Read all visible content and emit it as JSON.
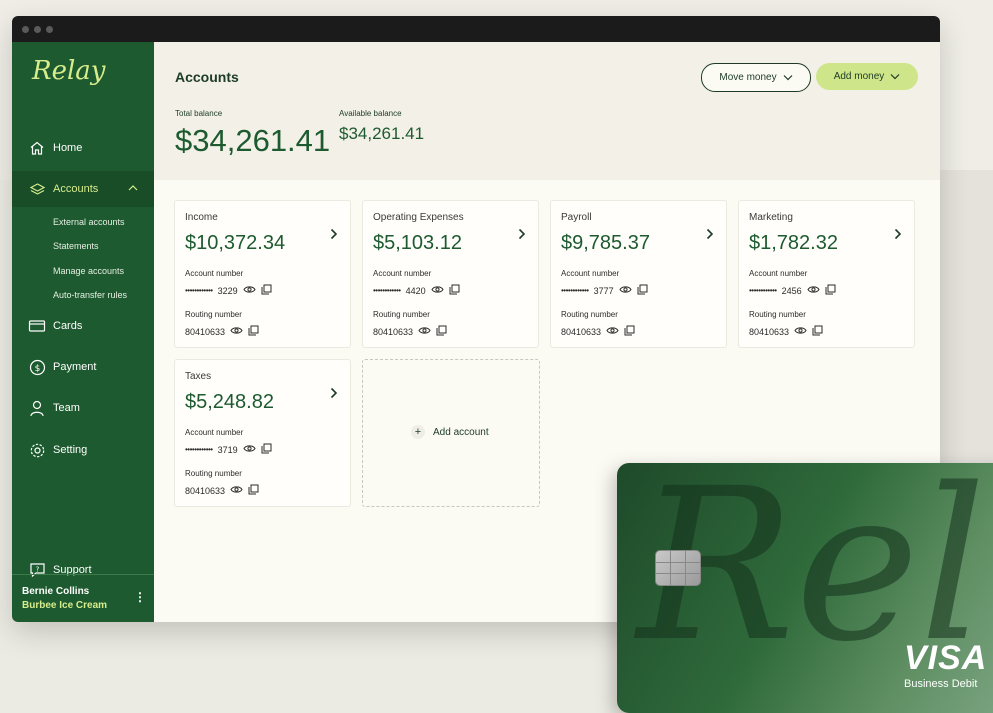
{
  "app": {
    "logo": "Relay"
  },
  "sidebar": {
    "items": [
      {
        "label": "Home",
        "icon": "home-icon"
      },
      {
        "label": "Accounts",
        "icon": "layers-icon",
        "active": true
      },
      {
        "label": "Cards",
        "icon": "card-icon"
      },
      {
        "label": "Payment",
        "icon": "dollar-icon"
      },
      {
        "label": "Team",
        "icon": "person-icon"
      },
      {
        "label": "Setting",
        "icon": "gear-icon"
      }
    ],
    "subitems": [
      "External accounts",
      "Statements",
      "Manage accounts",
      "Auto-transfer rules"
    ],
    "support": "Support",
    "user": {
      "name": "Bernie Collins",
      "business": "Burbee Ice Cream",
      "menu": "⋮"
    }
  },
  "header": {
    "title": "Accounts",
    "move_money": "Move money",
    "add_money": "Add money",
    "total_label": "Total balance",
    "total_value": "$34,261.41",
    "available_label": "Available balance",
    "available_value": "$34,261.41"
  },
  "accounts": [
    {
      "name": "Income",
      "amount": "$10,372.34",
      "account_label": "Account number",
      "account_mask": "••••••••••••",
      "account_last4": "3229",
      "routing_label": "Routing number",
      "routing": "80410633"
    },
    {
      "name": "Operating Expenses",
      "amount": "$5,103.12",
      "account_label": "Account number",
      "account_mask": "••••••••••••",
      "account_last4": "4420",
      "routing_label": "Routing number",
      "routing": "80410633"
    },
    {
      "name": "Payroll",
      "amount": "$9,785.37",
      "account_label": "Account number",
      "account_mask": "••••••••••••",
      "account_last4": "3777",
      "routing_label": "Routing number",
      "routing": "80410633"
    },
    {
      "name": "Marketing",
      "amount": "$1,782.32",
      "account_label": "Account number",
      "account_mask": "••••••••••••",
      "account_last4": "2456",
      "routing_label": "Routing number",
      "routing": "80410633"
    },
    {
      "name": "Taxes",
      "amount": "$5,248.82",
      "account_label": "Account number",
      "account_mask": "••••••••••••",
      "account_last4": "3719",
      "routing_label": "Routing number",
      "routing": "80410633"
    }
  ],
  "add_account": {
    "label": "Add account",
    "plus": "+"
  },
  "debit_card": {
    "brand": "VISA",
    "subtitle": "Business Debit",
    "script": "Relay"
  },
  "colors": {
    "sidebar": "#1d5a2f",
    "accent": "#cfe58a",
    "logo": "#d7ec8c",
    "text_dark": "#1d3b26"
  }
}
